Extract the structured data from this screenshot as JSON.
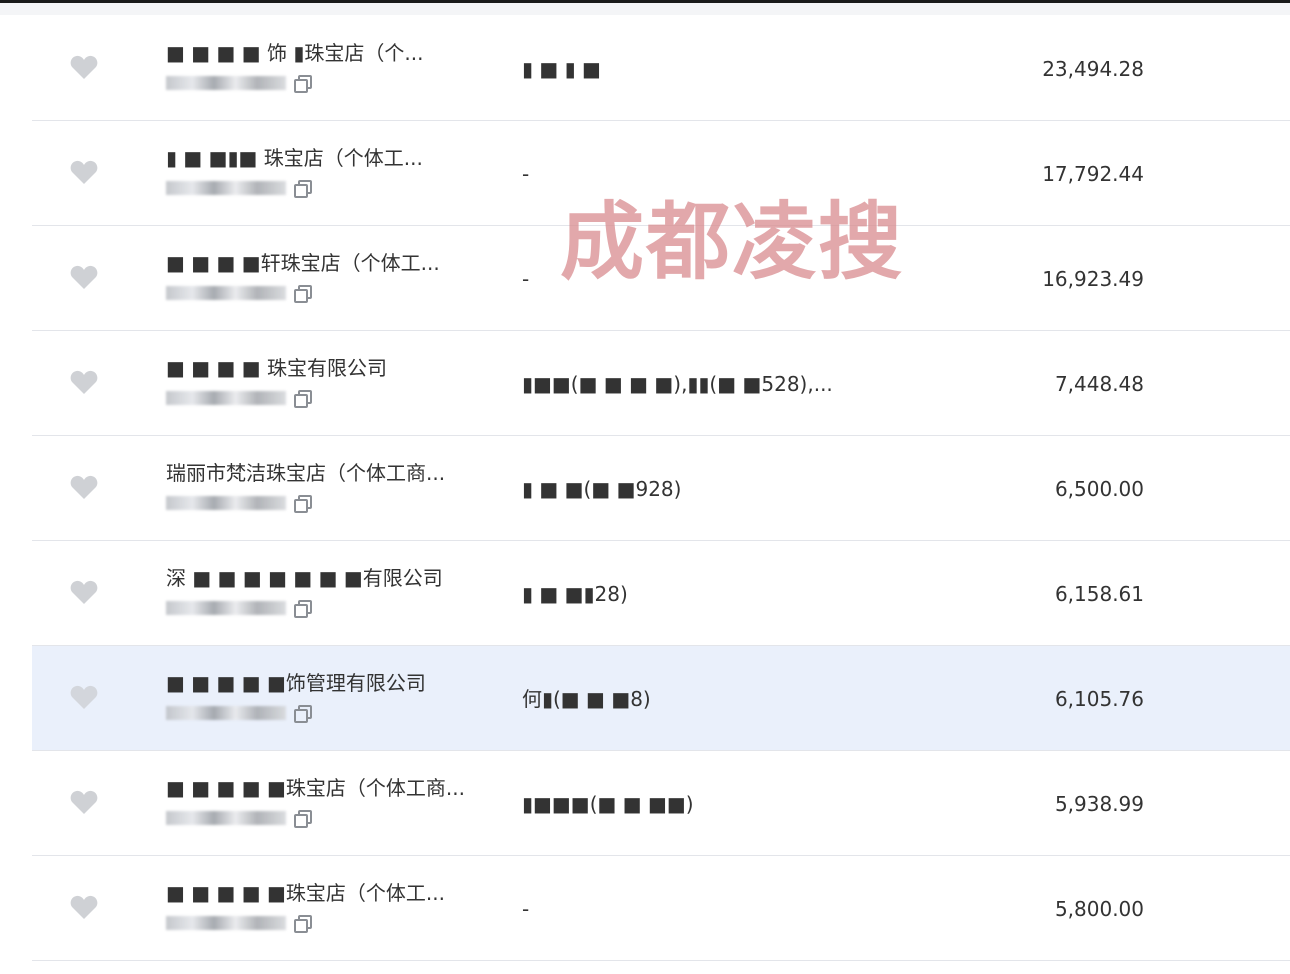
{
  "watermark": {
    "main_text": "成都凌搜",
    "color": "#d98c8f"
  },
  "colors": {
    "highlight_row": "#eaf0fb",
    "text": "#333333",
    "heart": "#cfd1d5",
    "divider": "#e3e5ea"
  },
  "rows": [
    {
      "name": "■ ■  ■ ■ 饰 ▮珠宝店（个...",
      "contact": "▮ ■  ▮ ■",
      "amount": "23,494.28"
    },
    {
      "name": "▮ ■  ■▮■ 珠宝店（个体工...",
      "contact": "-",
      "amount": "17,792.44"
    },
    {
      "name": "■ ■ ■ ■轩珠宝店（个体工...",
      "contact": "-",
      "amount": "16,923.49"
    },
    {
      "name": "■ ■ ■ ■ 珠宝有限公司",
      "contact": "▮■■(■ ■ ■ ■),▮▮(■ ■528),...",
      "amount": "7,448.48"
    },
    {
      "name": "瑞丽市梵洁珠宝店（个体工商...",
      "contact": "▮ ■ ■(■ ■928)",
      "amount": "6,500.00"
    },
    {
      "name": "深 ■ ■ ■ ■ ■  ■ ■有限公司",
      "contact": "▮ ■ ■▮28)",
      "amount": "6,158.61"
    },
    {
      "name": "■ ■ ■ ■ ■饰管理有限公司",
      "contact": "何▮(■ ■ ■8)",
      "amount": "6,105.76",
      "highlight": true
    },
    {
      "name": "■ ■ ■ ■ ■珠宝店（个体工商...",
      "contact": "▮■■■(■ ■ ■■)",
      "amount": "5,938.99"
    },
    {
      "name": "■ ■ ■ ■ ■珠宝店（个体工...",
      "contact": "-",
      "amount": "5,800.00"
    }
  ]
}
